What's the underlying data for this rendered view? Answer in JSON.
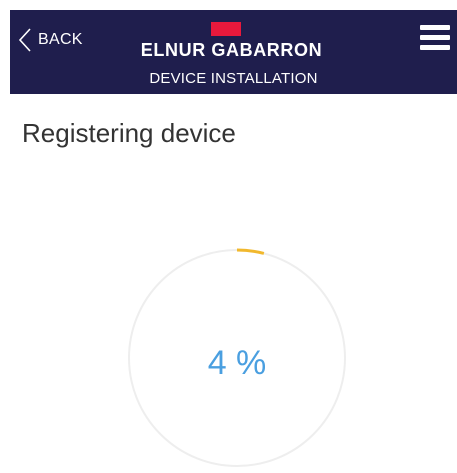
{
  "header": {
    "back_label": "BACK",
    "brand": "ELNUR GABARRON",
    "subtitle": "DEVICE INSTALLATION",
    "background_color": "#1f1e4d",
    "logo_color": "#e8193c"
  },
  "page": {
    "title": "Registering device"
  },
  "progress": {
    "value": 4,
    "label": "4 %",
    "value_color": "#4a9fe0",
    "arc_color": "#f1b82d",
    "track_color": "#eeeeee"
  },
  "icons": {
    "back": "chevron-left-icon",
    "menu": "hamburger-menu-icon"
  }
}
